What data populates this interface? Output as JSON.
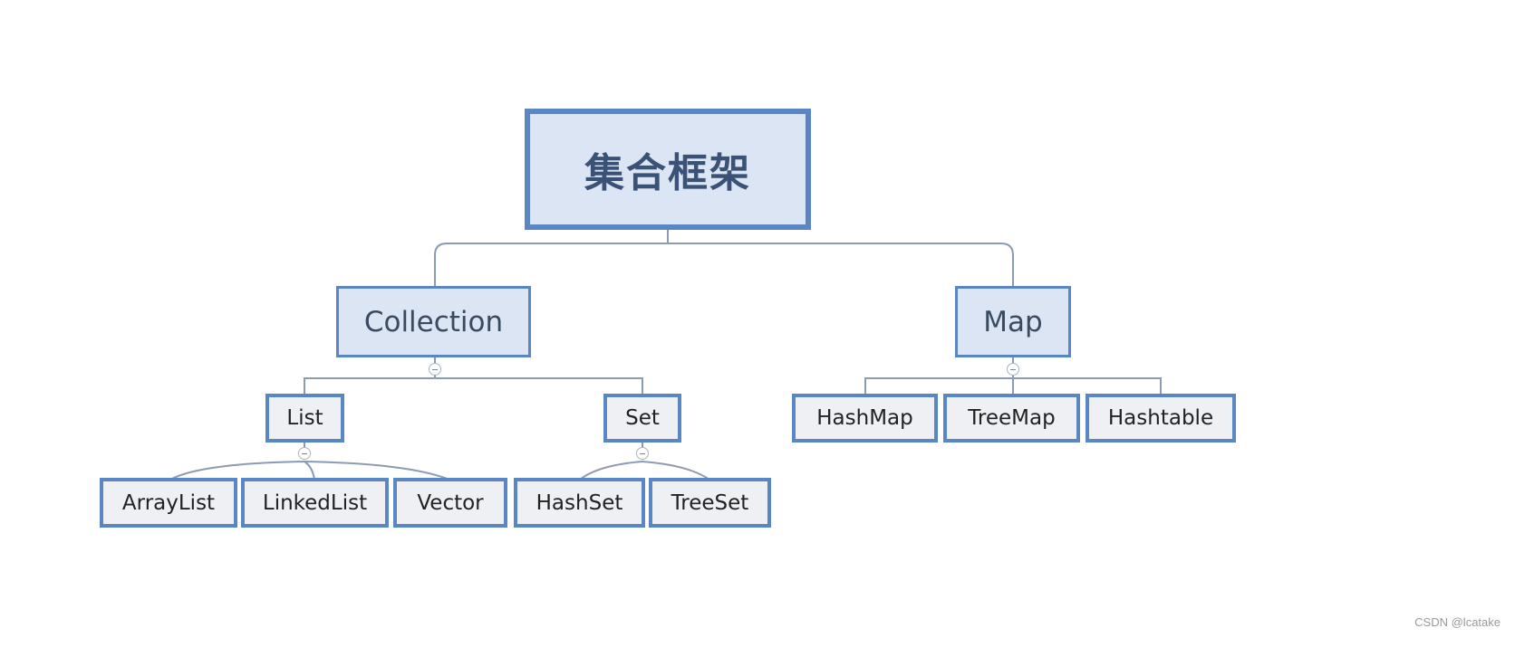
{
  "diagram": {
    "root": {
      "label": "集合框架"
    },
    "level1": [
      {
        "id": "collection",
        "label": "Collection"
      },
      {
        "id": "map",
        "label": "Map"
      }
    ],
    "collection_children": [
      {
        "id": "list",
        "label": "List"
      },
      {
        "id": "set",
        "label": "Set"
      }
    ],
    "list_children": [
      {
        "id": "arraylist",
        "label": "ArrayList"
      },
      {
        "id": "linkedlist",
        "label": "LinkedList"
      },
      {
        "id": "vector",
        "label": "Vector"
      }
    ],
    "set_children": [
      {
        "id": "hashset",
        "label": "HashSet"
      },
      {
        "id": "treeset",
        "label": "TreeSet"
      }
    ],
    "map_children": [
      {
        "id": "hashmap",
        "label": "HashMap"
      },
      {
        "id": "treemap",
        "label": "TreeMap"
      },
      {
        "id": "hashtable",
        "label": "Hashtable"
      }
    ],
    "colors": {
      "border": "#5b86c4",
      "fill_upper": "#dbe5f3",
      "fill_lower": "#eef0f4",
      "edge": "#8a9bb4",
      "root_text": "#3a5276"
    }
  },
  "watermark": "CSDN @lcatake"
}
